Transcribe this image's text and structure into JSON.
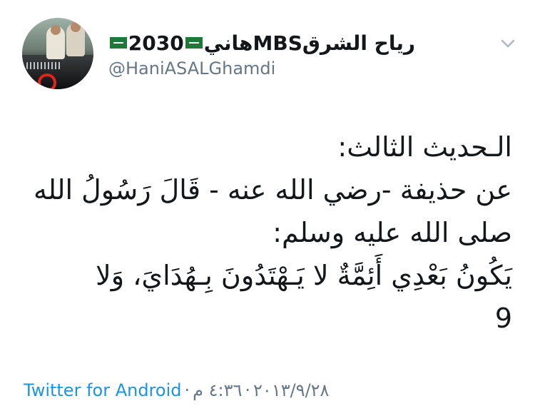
{
  "author": {
    "display_name_prefix": "رياح الشرق",
    "display_name_mid": "2030MBS",
    "display_name_suffix": "هاني",
    "flag_icon": "saudi-flag-icon",
    "handle": "@HaniASALGhamdi"
  },
  "menu": {
    "icon": "chevron-down-icon"
  },
  "tweet": {
    "lines": [
      "الـحديث الثالث:",
      "عن حذيفة -رضي الله عنه - قَالَ رَسُولُ الله",
      "صلى الله عليه وسلم:",
      "يَكُونُ بَعْدِي أَئِمَّةٌ لا يَـهْتَدُونَ بِـهُدَايَ، وَلا",
      "9"
    ]
  },
  "footer": {
    "source": "Twitter for Android",
    "separator": "·",
    "date": "٢٠١٣/٩/٢٨",
    "time": "٤:٣٦ م"
  },
  "colors": {
    "text": "#14171a",
    "secondary": "#657786",
    "link": "#1b95e0",
    "flag_green": "#1f7a3a"
  }
}
